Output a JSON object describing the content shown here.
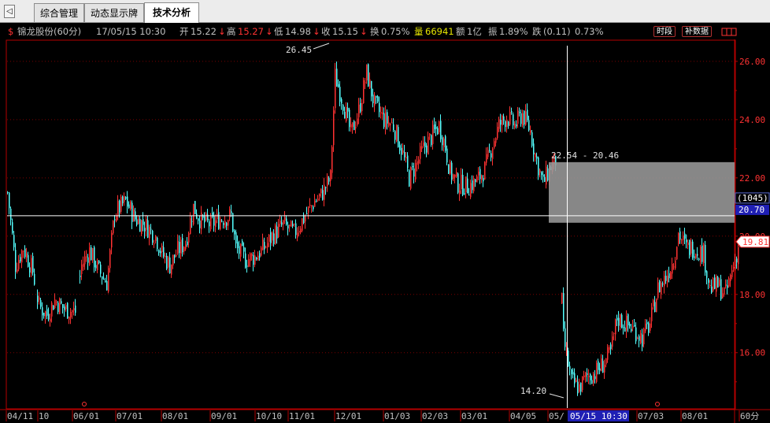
{
  "tabs": {
    "nav_arrow": "◁",
    "items": [
      {
        "label": "综合管理",
        "active": false
      },
      {
        "label": "动态显示牌",
        "active": false
      },
      {
        "label": "技术分析",
        "active": true
      }
    ]
  },
  "info": {
    "flag": "$",
    "stock": "锦龙股份(60分)",
    "datetime": "17/05/15 10:30",
    "open_label": "开",
    "open": "15.22",
    "open_arrow": "↓",
    "high_label": "高",
    "high": "15.27",
    "high_arrow": "↓",
    "low_label": "低",
    "low": "14.98",
    "low_arrow": "↓",
    "close_label": "收",
    "close": "15.15",
    "close_arrow": "↓",
    "turnover_label": "换",
    "turnover": "0.75%",
    "volume_label": "量",
    "volume": "66941",
    "amount_label": "额",
    "amount": "1亿",
    "amplitude_label": "振",
    "amplitude": "1.89%",
    "change_label": "跌",
    "change": "(0.11)",
    "change_pct": "0.73%",
    "btn_time": "时段",
    "btn_data": "补数据"
  },
  "colors": {
    "up": "#ff3232",
    "down": "#54ffff",
    "axis": "#b40000",
    "label": "#c0c0c0",
    "grid": "#7a0000"
  },
  "chart_data": {
    "type": "candlestick",
    "y_ticks": [
      16.0,
      18.0,
      20.0,
      22.0,
      24.0,
      26.0
    ],
    "ylim": [
      14.1,
      26.7
    ],
    "grid": true,
    "x_ticks": [
      "04/11",
      "10",
      "06/01",
      "07/01",
      "08/01",
      "09/01",
      "10/10",
      "11/01",
      "12/01",
      "01/03",
      "02/03",
      "03/01",
      "04/05",
      "05/",
      "07/03",
      "08/01",
      "60分"
    ],
    "annotations": {
      "max_label": "26.45",
      "min_label": "14.20",
      "range_label": "22.54 - 20.46",
      "range_high": 22.54,
      "range_low": 20.46,
      "crosshair_y": 20.7,
      "crosshair_y_label": "20.70",
      "crosshair_index_label": "(1045)",
      "crosshair_date_label": "05/15 10:30",
      "last_price_label": "19.81",
      "last_price": 19.81
    },
    "path": [
      [
        0,
        21.5
      ],
      [
        10,
        19.0
      ],
      [
        20,
        19.6
      ],
      [
        32,
        18.8
      ],
      [
        40,
        17.6
      ],
      [
        50,
        17.3
      ],
      [
        60,
        17.8
      ],
      [
        72,
        17.5
      ],
      [
        86,
        17.4
      ],
      [
        94,
        19.0
      ],
      [
        104,
        19.5
      ],
      [
        116,
        18.8
      ],
      [
        126,
        18.4
      ],
      [
        136,
        20.8
      ],
      [
        150,
        21.2
      ],
      [
        162,
        20.6
      ],
      [
        174,
        20.4
      ],
      [
        188,
        20.0
      ],
      [
        196,
        19.4
      ],
      [
        206,
        19.0
      ],
      [
        216,
        19.5
      ],
      [
        226,
        19.8
      ],
      [
        236,
        21.0
      ],
      [
        246,
        20.5
      ],
      [
        258,
        20.4
      ],
      [
        270,
        20.6
      ],
      [
        284,
        20.7
      ],
      [
        290,
        19.6
      ],
      [
        302,
        19.2
      ],
      [
        314,
        19.3
      ],
      [
        326,
        19.6
      ],
      [
        336,
        20.0
      ],
      [
        350,
        20.4
      ],
      [
        364,
        20.1
      ],
      [
        378,
        20.7
      ],
      [
        390,
        21.2
      ],
      [
        398,
        21.4
      ],
      [
        410,
        22.0
      ],
      [
        416,
        25.5
      ],
      [
        426,
        24.6
      ],
      [
        436,
        23.5
      ],
      [
        446,
        24.3
      ],
      [
        456,
        25.6
      ],
      [
        466,
        24.5
      ],
      [
        478,
        24.0
      ],
      [
        490,
        23.8
      ],
      [
        500,
        23.0
      ],
      [
        510,
        22.0
      ],
      [
        518,
        22.4
      ],
      [
        528,
        23.0
      ],
      [
        538,
        23.4
      ],
      [
        548,
        23.8
      ],
      [
        555,
        23.2
      ],
      [
        562,
        22.2
      ],
      [
        572,
        21.8
      ],
      [
        584,
        21.7
      ],
      [
        596,
        21.9
      ],
      [
        606,
        22.3
      ],
      [
        614,
        23.0
      ],
      [
        624,
        23.8
      ],
      [
        634,
        24.1
      ],
      [
        644,
        23.8
      ],
      [
        654,
        24.2
      ],
      [
        664,
        23.6
      ],
      [
        670,
        22.8
      ],
      [
        680,
        21.8
      ],
      [
        690,
        22.4
      ],
      [
        696,
        22.6
      ],
      [
        706,
        16.5
      ],
      [
        716,
        15.0
      ],
      [
        726,
        14.8
      ],
      [
        736,
        15.2
      ],
      [
        746,
        15.3
      ],
      [
        756,
        15.6
      ],
      [
        766,
        16.0
      ],
      [
        774,
        17.2
      ],
      [
        784,
        17.0
      ],
      [
        796,
        16.8
      ],
      [
        806,
        16.5
      ],
      [
        816,
        17.0
      ],
      [
        826,
        18.2
      ],
      [
        836,
        18.6
      ],
      [
        846,
        19.2
      ],
      [
        852,
        20.1
      ],
      [
        862,
        19.6
      ],
      [
        872,
        19.6
      ],
      [
        884,
        19.4
      ],
      [
        892,
        18.2
      ],
      [
        902,
        18.3
      ],
      [
        912,
        18.0
      ],
      [
        920,
        18.8
      ],
      [
        930,
        19.8
      ]
    ]
  }
}
